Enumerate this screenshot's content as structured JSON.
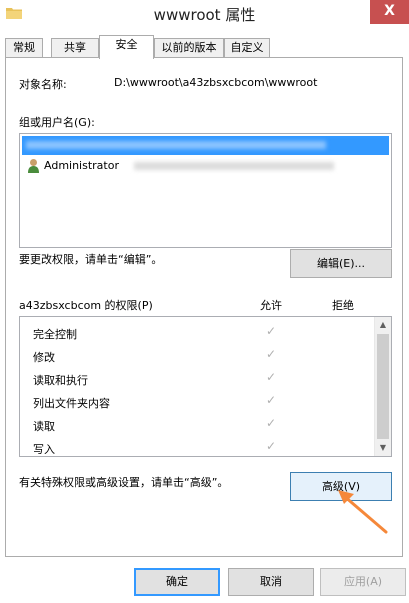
{
  "window": {
    "title": "wwwroot 属性",
    "close_label": "X"
  },
  "tabs": [
    {
      "label": "常规"
    },
    {
      "label": "共享"
    },
    {
      "label": "安全"
    },
    {
      "label": "以前的版本"
    },
    {
      "label": "自定义"
    }
  ],
  "security": {
    "object_label": "对象名称:",
    "object_value": "D:\\wwwroot\\a43zbsxcbcom\\wwwroot",
    "groups_label": "组或用户名(G):",
    "users": [
      {
        "name": "Administrator"
      }
    ],
    "edit_hint": "要更改权限，请单击“编辑”。",
    "edit_button": "编辑(E)...",
    "perm_header": "a43zbsxcbcom 的权限(P)",
    "allow_header": "允许",
    "deny_header": "拒绝",
    "permissions": [
      {
        "name": "完全控制",
        "allow": "✓"
      },
      {
        "name": "修改",
        "allow": "✓"
      },
      {
        "name": "读取和执行",
        "allow": "✓"
      },
      {
        "name": "列出文件夹内容",
        "allow": "✓"
      },
      {
        "name": "读取",
        "allow": "✓"
      },
      {
        "name": "写入",
        "allow": "✓"
      }
    ],
    "advanced_hint": "有关特殊权限或高级设置，请单击“高级”。",
    "advanced_button": "高级(V)"
  },
  "footer": {
    "ok": "确定",
    "cancel": "取消",
    "apply": "应用(A)"
  },
  "colors": {
    "selection": "#3399ff",
    "accent_arrow": "#f5883a"
  }
}
